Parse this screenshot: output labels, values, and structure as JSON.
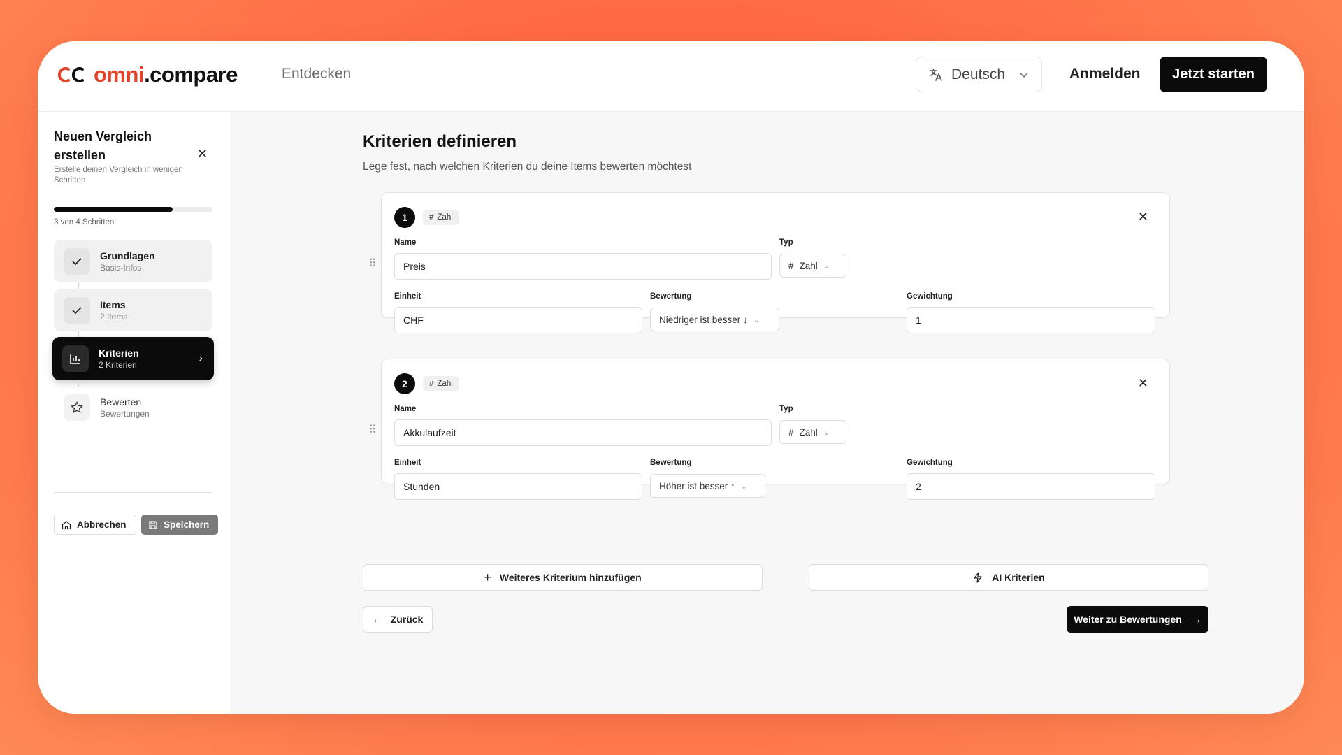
{
  "header": {
    "logo_prefix": "omni",
    "logo_suffix": ".compare",
    "nav_discover": "Entdecken",
    "language": "Deutsch",
    "login": "Anmelden",
    "cta": "Jetzt starten"
  },
  "sidebar": {
    "title": "Neuen Vergleich erstellen",
    "subtitle": "Erstelle deinen Vergleich in wenigen Schritten",
    "progress_fraction": 0.75,
    "steps_text": "3 von 4 Schritten",
    "steps": [
      {
        "label": "Grundlagen",
        "sub": "Basis-Infos",
        "state": "done"
      },
      {
        "label": "Items",
        "sub": "2 Items",
        "state": "done"
      },
      {
        "label": "Kriterien",
        "sub": "2 Kriterien",
        "state": "active"
      },
      {
        "label": "Bewerten",
        "sub": "Bewertungen",
        "state": "todo"
      }
    ],
    "cancel_label": "Abbrechen",
    "save_label": "Speichern"
  },
  "main": {
    "title": "Kriterien definieren",
    "description": "Lege fest, nach welchen Kriterien du deine Items bewerten möchtest",
    "labels": {
      "name": "Name",
      "type": "Typ",
      "unit": "Einheit",
      "rating": "Bewertung",
      "weight": "Gewichtung"
    },
    "criteria": [
      {
        "number": "1",
        "tag": "Zahl",
        "name": "Preis",
        "type": "Zahl",
        "unit": "CHF",
        "rating": "Niedriger ist besser ↓",
        "weight": "1"
      },
      {
        "number": "2",
        "tag": "Zahl",
        "name": "Akkulaufzeit",
        "type": "Zahl",
        "unit": "Stunden",
        "rating": "Höher ist besser ↑",
        "weight": "2"
      }
    ],
    "add_label": "Weiteres Kriterium hinzufügen",
    "ai_label": "AI Kriterien",
    "back_label": "Zurück",
    "next_label": "Weiter zu Bewertungen"
  }
}
